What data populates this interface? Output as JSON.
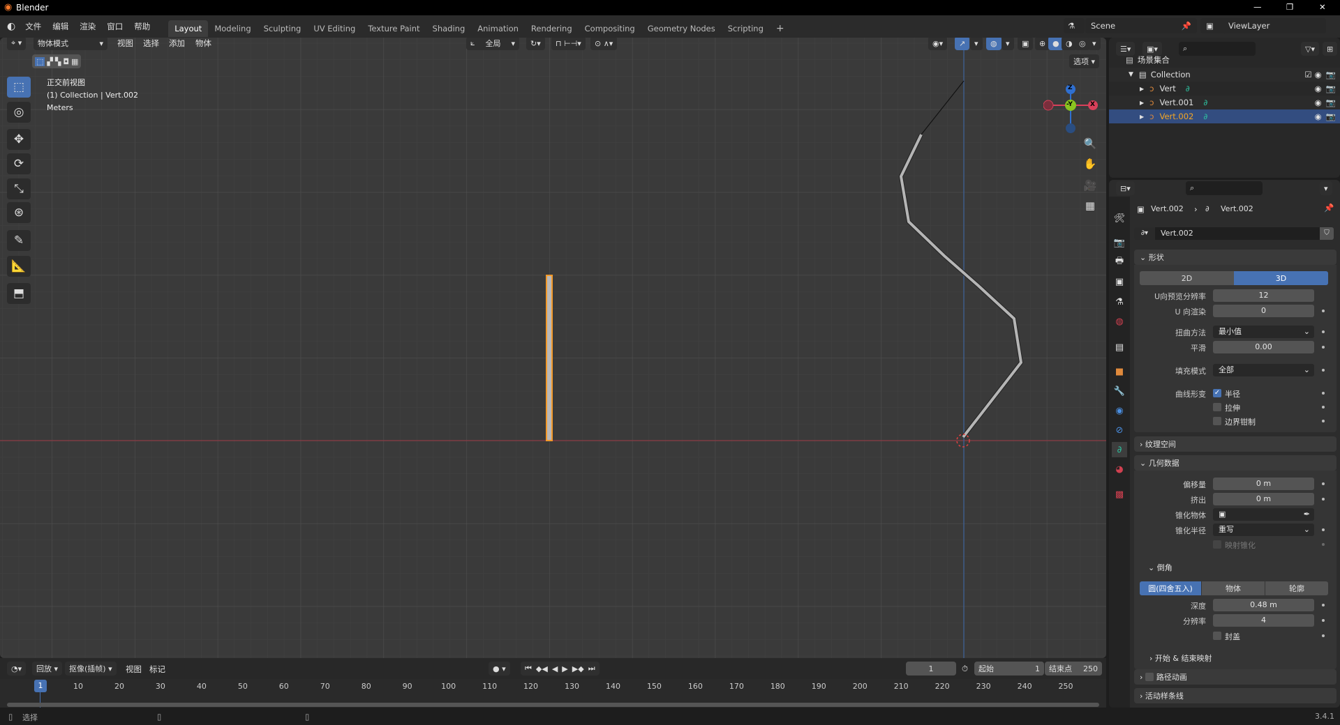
{
  "window": {
    "title": "Blender",
    "minimize": "—",
    "restore": "❐",
    "close": "✕"
  },
  "menu": [
    "文件",
    "编辑",
    "渲染",
    "窗口",
    "帮助"
  ],
  "workspaces": [
    "Layout",
    "Modeling",
    "Sculpting",
    "UV Editing",
    "Texture Paint",
    "Shading",
    "Animation",
    "Rendering",
    "Compositing",
    "Geometry Nodes",
    "Scripting"
  ],
  "add_workspace": "+",
  "scene": {
    "name": "Scene",
    "view_layer": "ViewLayer"
  },
  "viewport": {
    "mode": "物体模式",
    "menus": [
      "视图",
      "选择",
      "添加",
      "物体"
    ],
    "orientation": "全局",
    "options": "选项",
    "view_name": "正交前视图",
    "collection_info": "(1) Collection | Vert.002",
    "units": "Meters",
    "gizmo": {
      "z": "Z",
      "y": "-Y",
      "x": "X"
    }
  },
  "outliner": {
    "root": "场景集合",
    "collection": "Collection",
    "items": [
      {
        "name": "Vert"
      },
      {
        "name": "Vert.001"
      },
      {
        "name": "Vert.002",
        "selected": true
      }
    ]
  },
  "properties": {
    "breadcrumb_object": "Vert.002",
    "breadcrumb_data": "Vert.002",
    "datablock": "Vert.002",
    "shape": {
      "title": "形状",
      "dim_2d": "2D",
      "dim_3d": "3D",
      "dim_active": "3D",
      "rows": [
        {
          "label": "U向预览分辨率",
          "value": "12"
        },
        {
          "label": "U 向渲染",
          "value": "0"
        },
        {
          "label": "扭曲方法",
          "value": "最小值"
        },
        {
          "label": "平滑",
          "value": "0.00"
        },
        {
          "label": "填充模式",
          "value": "全部"
        }
      ],
      "deform_label": "曲线形变",
      "radius": "半径",
      "stretch": "拉伸",
      "bounds_clamp": "边界钳制"
    },
    "texture_space": "纹理空间",
    "geometry": {
      "title": "几何数据",
      "rows": [
        {
          "label": "偏移量",
          "value": "0 m"
        },
        {
          "label": "挤出",
          "value": "0 m"
        },
        {
          "label": "锥化物体",
          "value": ""
        },
        {
          "label": "锥化半径",
          "value": "重写"
        }
      ],
      "map_taper": "映射锥化"
    },
    "bevel": {
      "title": "倒角",
      "modes": [
        "圆(四舍五入)",
        "物体",
        "轮廓"
      ],
      "depth_label": "深度",
      "depth": "0.48 m",
      "res_label": "分辨率",
      "resolution": "4",
      "fill_caps": "封盖"
    },
    "start_end": "开始 & 结束映射",
    "path_anim": "路径动画",
    "active_spline": "活动样条线"
  },
  "timeline": {
    "menus": [
      "回放",
      "抠像(插帧)",
      "视图",
      "标记"
    ],
    "current_frame": "1",
    "start_label": "起始",
    "start": "1",
    "end_label": "结束点",
    "end": "250",
    "ticks": [
      "10",
      "20",
      "30",
      "40",
      "50",
      "60",
      "70",
      "80",
      "90",
      "100",
      "110",
      "120",
      "130",
      "140",
      "150",
      "160",
      "170",
      "180",
      "190",
      "200",
      "210",
      "220",
      "230",
      "240",
      "250"
    ]
  },
  "status": {
    "select": "选择",
    "version": "3.4.1"
  }
}
